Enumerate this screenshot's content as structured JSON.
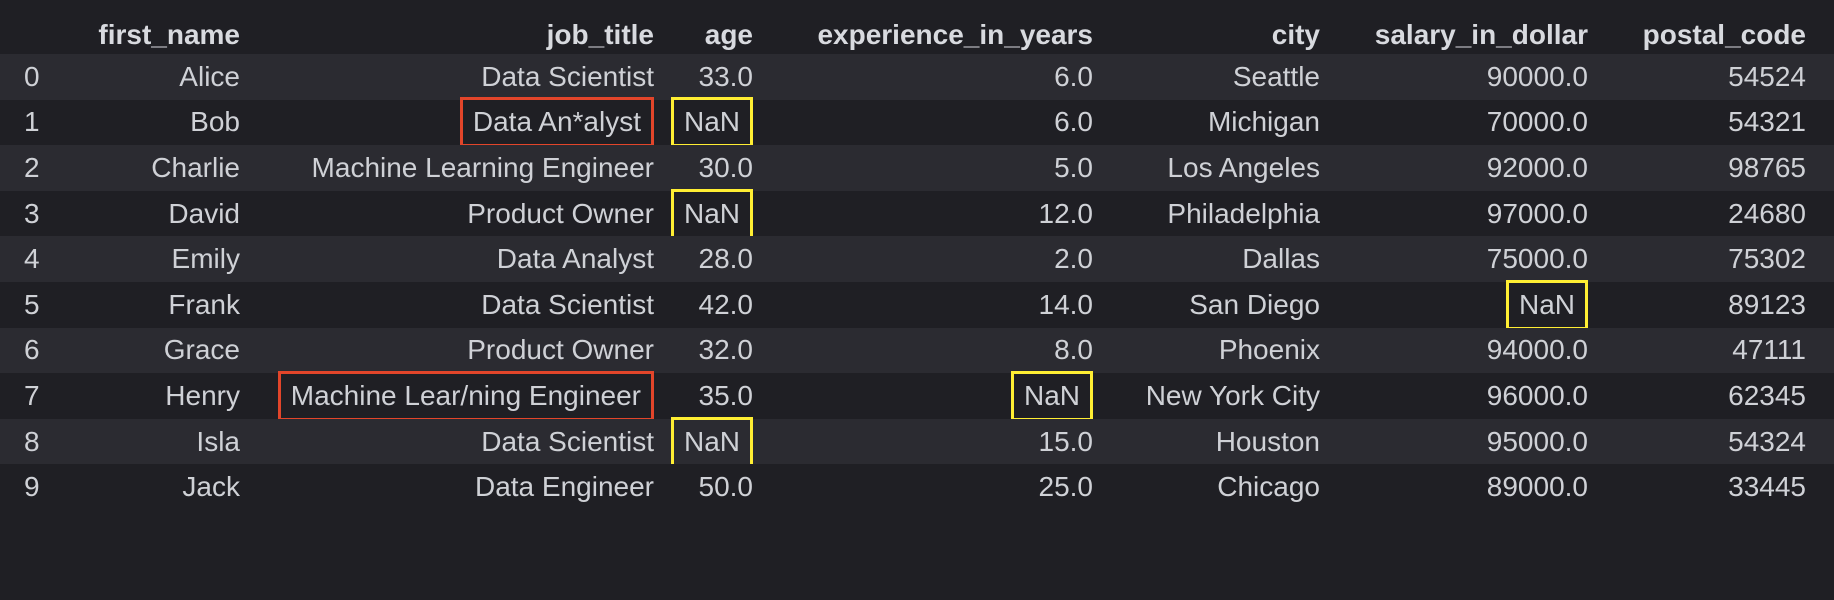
{
  "table": {
    "columns": [
      "",
      "first_name",
      "job_title",
      "age",
      "experience_in_years",
      "city",
      "salary_in_dollar",
      "postal_code"
    ],
    "rows": [
      {
        "index": "0",
        "first_name": "Alice",
        "job_title": "Data Scientist",
        "age": "33.0",
        "experience_in_years": "6.0",
        "city": "Seattle",
        "salary_in_dollar": "90000.0",
        "postal_code": "54524"
      },
      {
        "index": "1",
        "first_name": "Bob",
        "job_title": "Data An*alyst",
        "age": "NaN",
        "experience_in_years": "6.0",
        "city": "Michigan",
        "salary_in_dollar": "70000.0",
        "postal_code": "54321"
      },
      {
        "index": "2",
        "first_name": "Charlie",
        "job_title": "Machine Learning Engineer",
        "age": "30.0",
        "experience_in_years": "5.0",
        "city": "Los Angeles",
        "salary_in_dollar": "92000.0",
        "postal_code": "98765"
      },
      {
        "index": "3",
        "first_name": "David",
        "job_title": "Product Owner",
        "age": "NaN",
        "experience_in_years": "12.0",
        "city": "Philadelphia",
        "salary_in_dollar": "97000.0",
        "postal_code": "24680"
      },
      {
        "index": "4",
        "first_name": "Emily",
        "job_title": "Data Analyst",
        "age": "28.0",
        "experience_in_years": "2.0",
        "city": "Dallas",
        "salary_in_dollar": "75000.0",
        "postal_code": "75302"
      },
      {
        "index": "5",
        "first_name": "Frank",
        "job_title": "Data Scientist",
        "age": "42.0",
        "experience_in_years": "14.0",
        "city": "San Diego",
        "salary_in_dollar": "NaN",
        "postal_code": "89123"
      },
      {
        "index": "6",
        "first_name": "Grace",
        "job_title": "Product Owner",
        "age": "32.0",
        "experience_in_years": "8.0",
        "city": "Phoenix",
        "salary_in_dollar": "94000.0",
        "postal_code": "47111"
      },
      {
        "index": "7",
        "first_name": "Henry",
        "job_title": "Machine Lear/ning Engineer",
        "age": "35.0",
        "experience_in_years": "NaN",
        "city": "New York City",
        "salary_in_dollar": "96000.0",
        "postal_code": "62345"
      },
      {
        "index": "8",
        "first_name": "Isla",
        "job_title": "Data Scientist",
        "age": "NaN",
        "experience_in_years": "15.0",
        "city": "Houston",
        "salary_in_dollar": "95000.0",
        "postal_code": "54324"
      },
      {
        "index": "9",
        "first_name": "Jack",
        "job_title": "Data Engineer",
        "age": "50.0",
        "experience_in_years": "25.0",
        "city": "Chicago",
        "salary_in_dollar": "89000.0",
        "postal_code": "33445"
      }
    ]
  },
  "highlights": {
    "missing_value_color": "#ffee33",
    "invalid_text_color": "#e2452a"
  },
  "colors": {
    "background": "#1f1f24",
    "stripe": "#2b2b31",
    "text": "#cfd1d6"
  }
}
